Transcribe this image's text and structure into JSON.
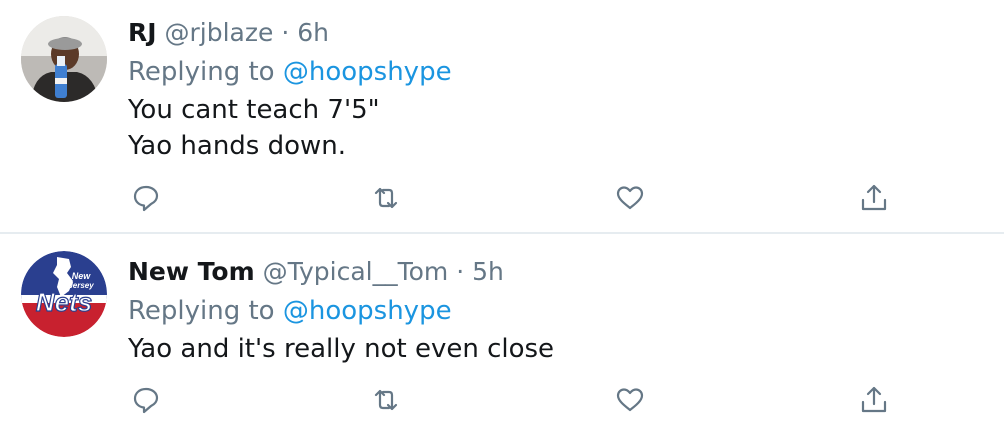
{
  "tweets": [
    {
      "name": "RJ",
      "handle": "@rjblaze",
      "separator": "·",
      "time": "6h",
      "replying_prefix": "Replying to",
      "replying_to": "@hoopshype",
      "text_lines": [
        "You cant teach 7'5\"",
        "Yao hands down."
      ],
      "avatar_icon": "user-photo-avatar"
    },
    {
      "name": "New Tom",
      "handle": "@Typical__Tom",
      "separator": "·",
      "time": "5h",
      "replying_prefix": "Replying to",
      "replying_to": "@hoopshype",
      "text_lines": [
        "Yao and it's really not even close"
      ],
      "avatar_icon": "new-jersey-nets-logo-avatar",
      "avatar_text": "New Jersey Nets"
    }
  ],
  "colors": {
    "text": "#14171a",
    "secondary": "#657786",
    "link": "#1b95e0",
    "divider": "#e6ecf0",
    "nets_blue": "#2a3f8f",
    "nets_red": "#c8212f"
  },
  "action_icons": [
    "reply-icon",
    "retweet-icon",
    "like-icon",
    "share-icon"
  ]
}
